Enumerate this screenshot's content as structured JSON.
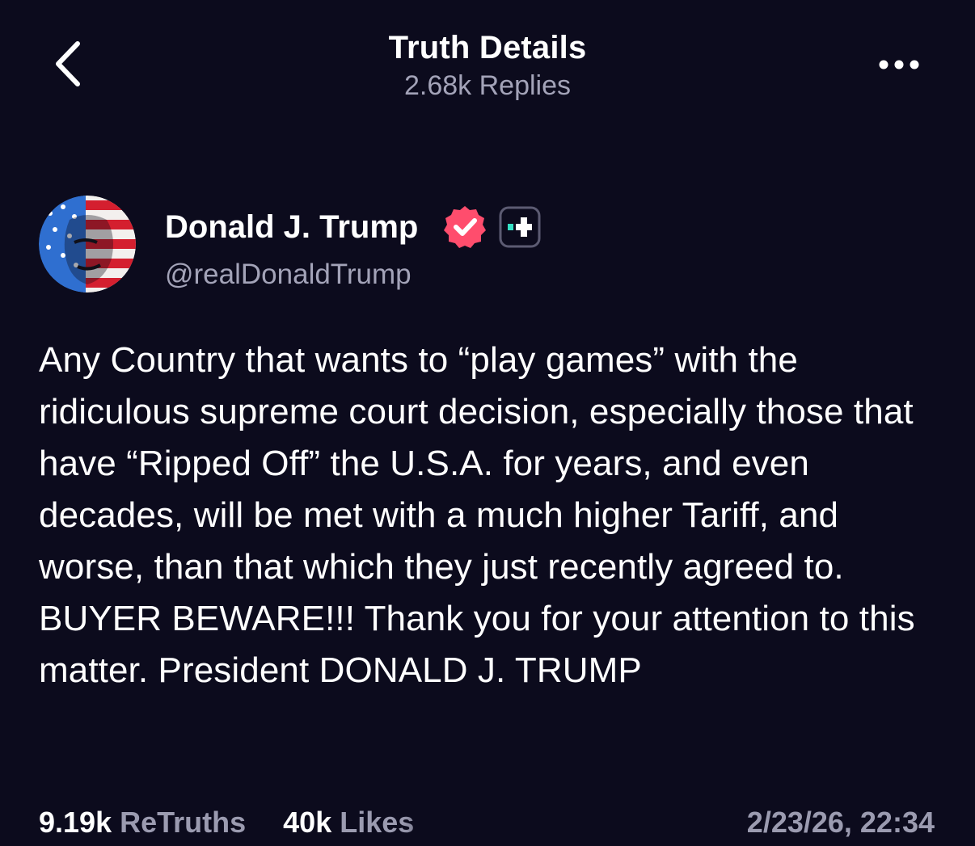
{
  "header": {
    "title": "Truth Details",
    "subtitle": "2.68k Replies",
    "back_icon": "chevron-left-icon",
    "more_icon": "more-horizontal-icon"
  },
  "author": {
    "name": "Donald J. Trump",
    "handle": "@realDonaldTrump",
    "verified_icon": "verified-badge-icon",
    "verified_color": "#ff4d6d",
    "plus_icon": "truth-plus-icon",
    "plus_color": "#35e0c4"
  },
  "post": {
    "text": "Any Country that wants to “play games” with the ridiculous supreme court decision, especially those that have “Ripped Off” the U.S.A. for years, and even decades, will be met with a much higher Tariff, and worse, than that which they just recently agreed to. BUYER BEWARE!!! Thank you for your attention to this matter. President DONALD J. TRUMP",
    "retruths_count": "9.19k",
    "retruths_label": "ReTruths",
    "likes_count": "40k",
    "likes_label": "Likes",
    "timestamp": "2/23/26, 22:34"
  },
  "colors": {
    "background": "#0c0b1d",
    "primary_text": "#ffffff",
    "secondary_text": "#a3a3b8"
  }
}
